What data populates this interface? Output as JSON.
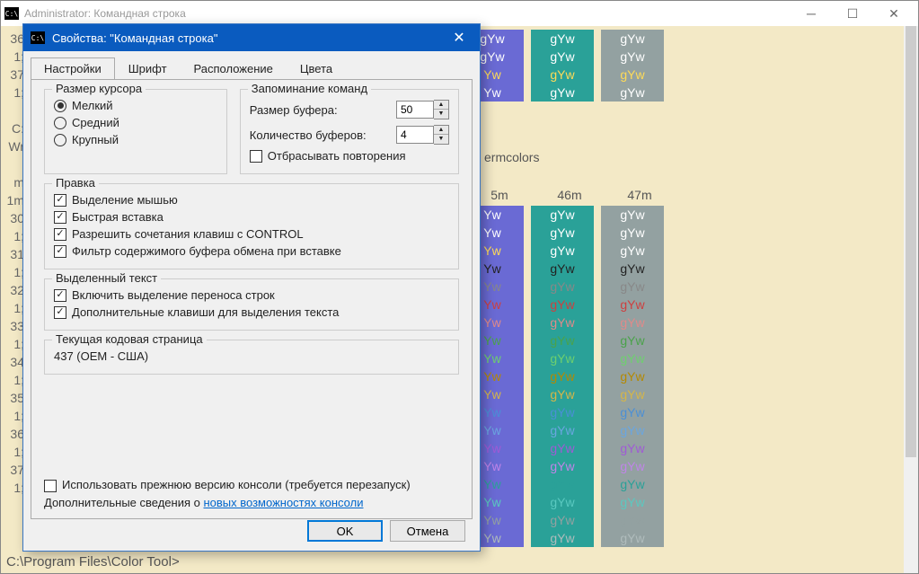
{
  "console": {
    "title": "Administrator: Командная строка",
    "prompt": "C:\\Program Files\\Color Tool>",
    "extra_line1": "ermcolors",
    "col_headers": [
      "5m",
      "46m",
      "47m"
    ],
    "left_gutter": [
      "36",
      "1;",
      "37",
      "1;",
      "",
      "C:",
      "Wr",
      "",
      "m",
      "1m",
      "30",
      "1;",
      "31",
      "1;",
      "32",
      "1;",
      "33",
      "1;",
      "34",
      "1;",
      "35",
      "1;",
      "36",
      "1;",
      "37",
      "1;",
      ""
    ],
    "swatch_text": "gYw",
    "swatch_yw": "Yw",
    "row_colors": [
      {
        "c45": "#ffffff",
        "c46": "#ffffff",
        "c47": "#ffffff"
      },
      {
        "c45": "#ffffff",
        "c46": "#ffffff",
        "c47": "#ffffff"
      },
      {
        "c45": "#ffdb57",
        "c46": "#ffffff",
        "c47": "#ffffff"
      },
      {
        "c45": "#222222",
        "c46": "#222222",
        "c47": "#222222"
      },
      {
        "c45": "#888888",
        "c46": "#888888",
        "c47": "#888888"
      },
      {
        "c45": "#ce3f3f",
        "c46": "#ce3f3f",
        "c47": "#ce3f3f"
      },
      {
        "c45": "#e08a8a",
        "c46": "#e08a8a",
        "c47": "#e08a8a"
      },
      {
        "c45": "#4aa24a",
        "c46": "#4aa24a",
        "c47": "#4aa24a"
      },
      {
        "c45": "#6ed06e",
        "c46": "#6ed06e",
        "c47": "#6ed06e"
      },
      {
        "c45": "#b58900",
        "c46": "#b58900",
        "c47": "#b58900"
      },
      {
        "c45": "#d6b648",
        "c46": "#d6b648",
        "c47": "#d6b648"
      },
      {
        "c45": "#4a8fd6",
        "c46": "#4a8fd6",
        "c47": "#4a8fd6"
      },
      {
        "c45": "#6aa6e0",
        "c46": "#6aa6e0",
        "c47": "#6aa6e0"
      },
      {
        "c45": "#a05ad6",
        "c46": "#a05ad6",
        "c47": "#a05ad6"
      },
      {
        "c45": "#c084e8",
        "c46": "#c084e8",
        "c47": "#c084e8"
      },
      {
        "c45": "#2aa198",
        "c46": "#2aa198",
        "c47": "#2aa198"
      },
      {
        "c45": "#5ac9c0",
        "c46": "#5ac9c0",
        "c47": "#5ac9c0"
      },
      {
        "c45": "#93a1a1",
        "c46": "#93a1a1",
        "c47": "#93a1a1"
      },
      {
        "c45": "#b0bcbc",
        "c46": "#b0bcbc",
        "c47": "#b0bcbc"
      }
    ]
  },
  "dialog": {
    "title": "Свойства: \"Командная строка\"",
    "tabs": [
      "Настройки",
      "Шрифт",
      "Расположение",
      "Цвета"
    ],
    "active_tab": 0,
    "cursor_group": {
      "legend": "Размер курсора",
      "options": [
        "Мелкий",
        "Средний",
        "Крупный"
      ],
      "selected": 0
    },
    "history_group": {
      "legend": "Запоминание команд",
      "buffer_size_label": "Размер буфера:",
      "buffer_size_value": "50",
      "num_buffers_label": "Количество буферов:",
      "num_buffers_value": "4",
      "discard_label": "Отбрасывать повторения",
      "discard_checked": false
    },
    "edit_group": {
      "legend": "Правка",
      "items": [
        {
          "label": "Выделение мышью",
          "checked": true
        },
        {
          "label": "Быстрая вставка",
          "checked": true
        },
        {
          "label": "Разрешить сочетания клавиш с CONTROL",
          "checked": true
        },
        {
          "label": "Фильтр содержимого буфера обмена при вставке",
          "checked": true
        }
      ]
    },
    "selected_text_group": {
      "legend": "Выделенный текст",
      "items": [
        {
          "label": "Включить выделение переноса строк",
          "checked": true
        },
        {
          "label": "Дополнительные клавиши для выделения текста",
          "checked": true
        }
      ]
    },
    "codepage_group": {
      "legend": "Текущая кодовая страница",
      "value": "437  (OEM - США)"
    },
    "legacy": {
      "label": "Использовать прежнюю версию консоли (требуется перезапуск)",
      "checked": false,
      "more_info_prefix": "Дополнительные сведения о ",
      "more_info_link": "новых возможностях консоли"
    },
    "buttons": {
      "ok": "OK",
      "cancel": "Отмена"
    }
  }
}
